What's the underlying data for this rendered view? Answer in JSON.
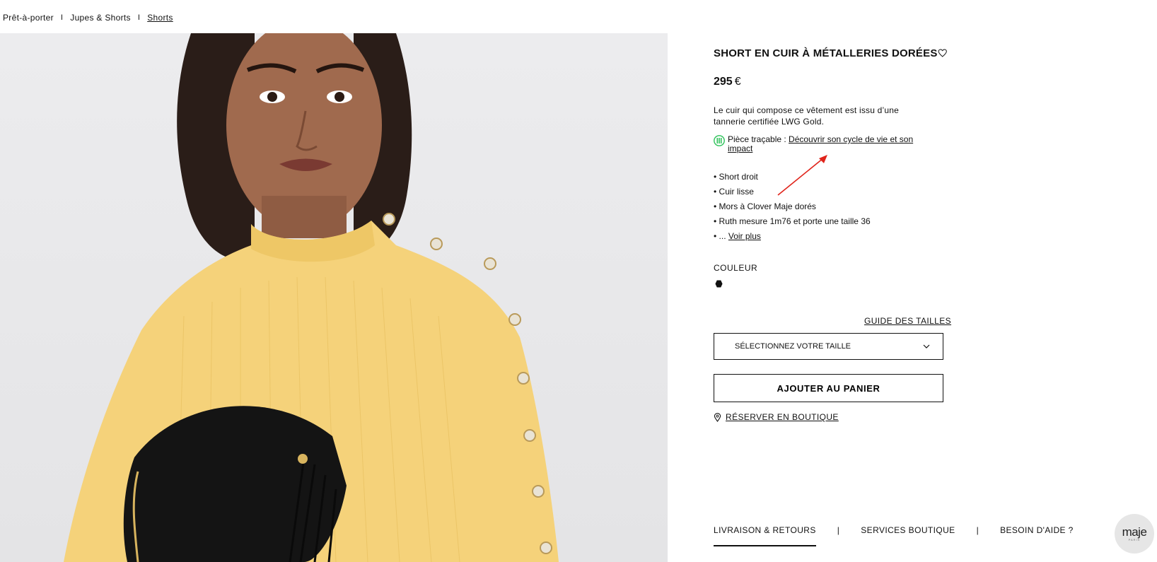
{
  "breadcrumb": {
    "items": [
      "Prêt-à-porter",
      "Jupes & Shorts",
      "Shorts"
    ],
    "separator": "I"
  },
  "product": {
    "title": "SHORT EN CUIR À MÉTALLERIES DORÉES",
    "price_amount": "295",
    "price_currency": "€",
    "description": "Le cuir qui compose ce vêtement est issu d’une tannerie certifiée LWG Gold.",
    "trace_prefix": "Pièce traçable : ",
    "trace_link": "Découvrir son cycle de vie et son impact",
    "bullets": [
      "• Short droit",
      "• Cuir lisse",
      "• Mors à Clover Maje dorés",
      "• Ruth mesure 1m76 et porte une taille 36"
    ],
    "more_prefix": "• ... ",
    "more_link": "Voir plus",
    "color_label": "COULEUR",
    "color_swatch": "#111111",
    "size_guide": "GUIDE DES TAILLES",
    "size_select": "SÉLECTIONNEZ VOTRE TAILLE",
    "add_to_cart": "AJOUTER AU PANIER",
    "reserve": "RÉSERVER EN BOUTIQUE"
  },
  "tabs": {
    "items": [
      "LIVRAISON & RETOURS",
      "SERVICES BOUTIQUE",
      "BESOIN D'AIDE ?"
    ],
    "separator": "|",
    "active_index": 0
  },
  "chat": {
    "brand": "maje",
    "sub": "PARIS"
  },
  "colors": {
    "sweater": "#f5d27a",
    "trace_badge": "#2ec25a",
    "annotation": "#e0241b"
  }
}
